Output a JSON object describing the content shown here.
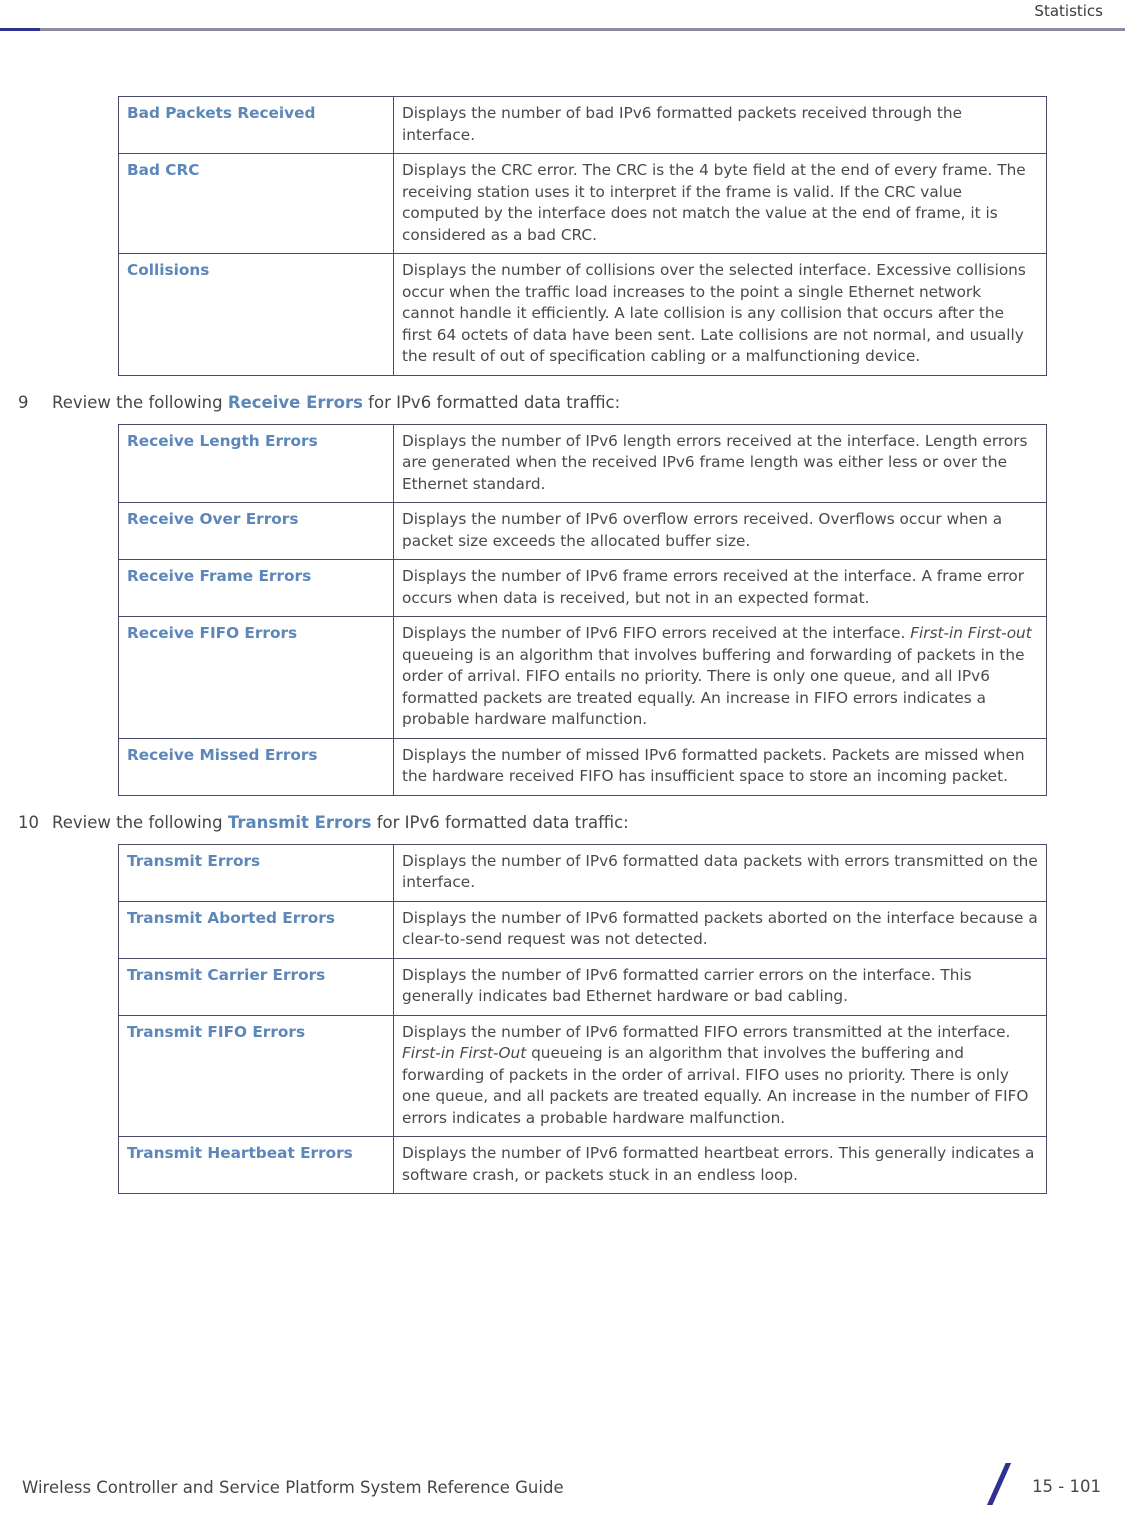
{
  "header": {
    "title": "Statistics"
  },
  "tables": [
    {
      "id": "general-errors-table",
      "rows": [
        {
          "term": "Bad Packets Received",
          "desc": "Displays the number of bad IPv6 formatted packets received through the interface."
        },
        {
          "term": "Bad CRC",
          "desc": "Displays the CRC error. The CRC is the 4 byte field at the end of every frame. The receiving station uses it to interpret if the frame is valid. If the CRC value computed by the interface does not match the value at the end of frame, it is considered as a bad CRC."
        },
        {
          "term": "Collisions",
          "desc": "Displays the number of collisions over the selected interface. Excessive collisions occur when the traffic load increases to the point a single Ethernet network cannot handle it efficiently. A late collision is any collision that occurs after the first 64 octets of data have been sent. Late collisions are not normal, and usually the result of out of specification cabling or a malfunctioning device."
        }
      ]
    },
    {
      "id": "receive-errors-table",
      "rows": [
        {
          "term": "Receive Length Errors",
          "desc": "Displays the number of IPv6 length errors received at the interface. Length errors are generated when the received IPv6 frame length was either less or over the Ethernet standard."
        },
        {
          "term": "Receive Over Errors",
          "desc": "Displays the number of IPv6 overflow errors received. Overflows occur when a packet size exceeds the allocated buffer size."
        },
        {
          "term": "Receive Frame Errors",
          "desc": "Displays the number of IPv6 frame errors received at the interface. A frame error occurs when data is received, but not in an expected format."
        },
        {
          "term": "Receive FIFO Errors",
          "desc_pre": "Displays the number of IPv6 FIFO errors received at the interface. ",
          "desc_em": "First-in First-out",
          "desc_post": " queueing is an algorithm that involves buffering and forwarding of packets in the order of arrival. FIFO entails no priority. There is only one queue, and all IPv6 formatted packets are treated equally. An increase in FIFO errors indicates a probable hardware malfunction."
        },
        {
          "term": "Receive Missed Errors",
          "desc": "Displays the number of missed IPv6 formatted packets. Packets are missed when the hardware received FIFO has insufficient space to store an incoming packet."
        }
      ]
    },
    {
      "id": "transmit-errors-table",
      "rows": [
        {
          "term": "Transmit Errors",
          "desc": "Displays the number of IPv6 formatted data packets with errors transmitted on the interface."
        },
        {
          "term": "Transmit Aborted Errors",
          "desc": "Displays the number of IPv6 formatted packets aborted on the interface because a clear-to-send request was not detected."
        },
        {
          "term": "Transmit Carrier Errors",
          "desc": "Displays the number of IPv6 formatted carrier errors on the interface. This generally indicates bad Ethernet hardware or bad cabling."
        },
        {
          "term": "Transmit FIFO Errors",
          "desc_pre": "Displays the number of IPv6 formatted FIFO errors transmitted at the interface. ",
          "desc_em": "First-in First-Out",
          "desc_post": " queueing is an algorithm that involves the buffering and forwarding of packets in the order of arrival. FIFO uses no priority. There is only one queue, and all packets are treated equally. An increase in the number of FIFO errors indicates a probable hardware malfunction."
        },
        {
          "term": "Transmit Heartbeat Errors",
          "desc": "Displays the number of IPv6 formatted heartbeat errors. This generally indicates a software crash, or packets stuck in an endless loop."
        }
      ]
    }
  ],
  "steps": [
    {
      "num": "9",
      "pre": "Review the following ",
      "accent": "Receive Errors",
      "post": " for IPv6 formatted data traffic:"
    },
    {
      "num": "10",
      "pre": "Review the following ",
      "accent": "Transmit Errors",
      "post": " for IPv6 formatted data traffic:"
    }
  ],
  "footer": {
    "guide": "Wireless Controller and Service Platform System Reference Guide",
    "page": "15 - 101"
  },
  "colors": {
    "accent": "#5c87b8",
    "brand": "#2e3192",
    "rule": "#8c8c9e",
    "border": "#4a4a6a"
  }
}
